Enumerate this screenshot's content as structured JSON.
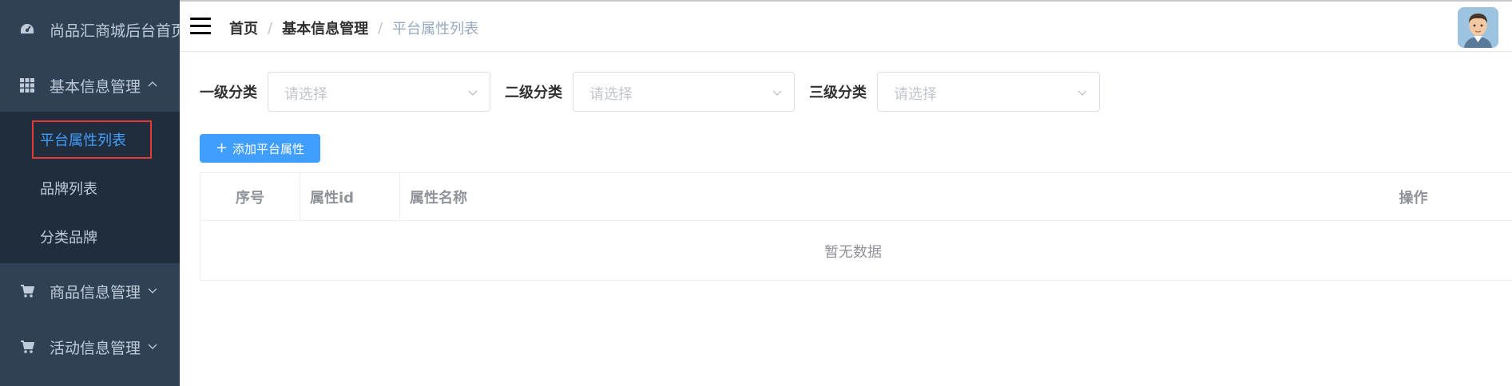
{
  "sidebar": {
    "items": [
      {
        "label": "尚品汇商城后台首页",
        "icon": "dashboard-icon"
      },
      {
        "label": "基本信息管理",
        "icon": "grid-icon"
      },
      {
        "label": "商品信息管理",
        "icon": "cart-icon"
      },
      {
        "label": "活动信息管理",
        "icon": "cart-icon"
      }
    ],
    "submenu": [
      {
        "label": "平台属性列表",
        "active": true
      },
      {
        "label": "品牌列表"
      },
      {
        "label": "分类品牌"
      }
    ]
  },
  "header": {
    "breadcrumb": [
      "首页",
      "基本信息管理",
      "平台属性列表"
    ],
    "separator": "/"
  },
  "filters": [
    {
      "label": "一级分类",
      "placeholder": "请选择"
    },
    {
      "label": "二级分类",
      "placeholder": "请选择"
    },
    {
      "label": "三级分类",
      "placeholder": "请选择"
    }
  ],
  "add_button": {
    "label": "添加平台属性",
    "icon": "plus-icon"
  },
  "table": {
    "columns": [
      "序号",
      "属性id",
      "属性名称",
      "操作"
    ],
    "empty_text": "暂无数据"
  },
  "colors": {
    "sidebar_bg": "#304156",
    "submenu_bg": "#1f2d3d",
    "accent": "#409eff",
    "highlight": "#e53935"
  }
}
